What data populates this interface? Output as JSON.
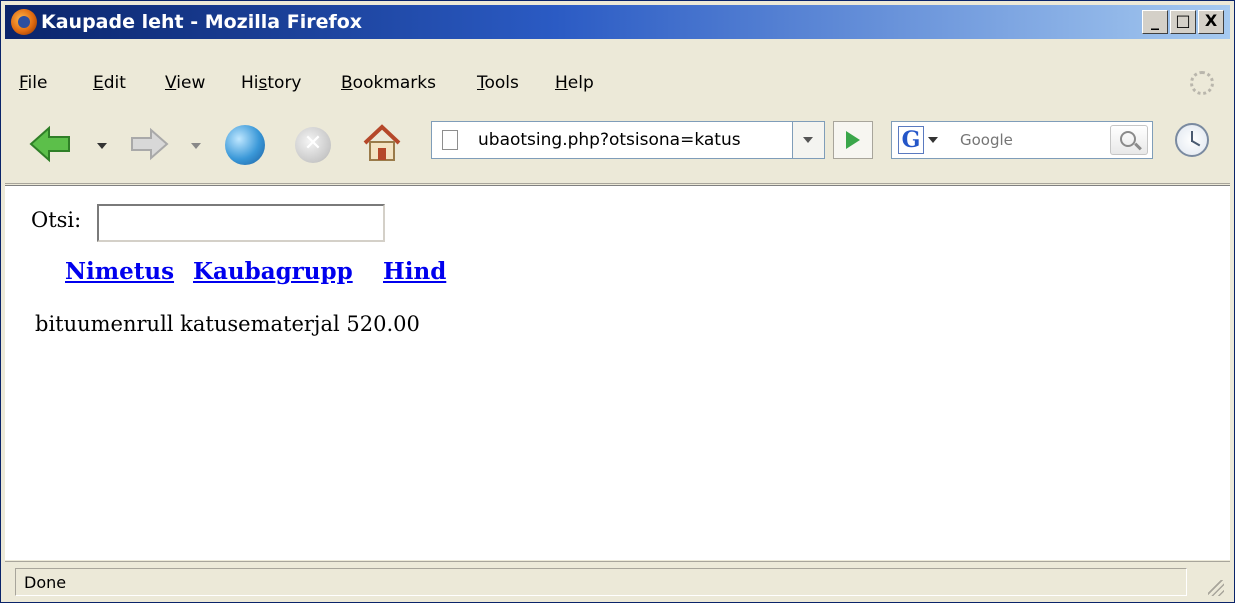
{
  "window": {
    "title": "Kaupade leht - Mozilla Firefox",
    "minimize_label": "_",
    "maximize_label": "□",
    "close_label": "X"
  },
  "menu": {
    "items": [
      {
        "accel": "F",
        "rest": "ile"
      },
      {
        "accel": "E",
        "rest": "dit"
      },
      {
        "accel": "V",
        "rest": "iew"
      },
      {
        "pre": "Hi",
        "accel": "s",
        "rest": "tory"
      },
      {
        "accel": "B",
        "rest": "ookmarks"
      },
      {
        "accel": "T",
        "rest": "ools"
      },
      {
        "accel": "H",
        "rest": "elp"
      }
    ]
  },
  "toolbar": {
    "url": "ubaotsing.php?otsisona=katus",
    "search_placeholder": "Google",
    "stop_glyph": "✕"
  },
  "page": {
    "search_label": "Otsi:",
    "search_value": "",
    "columns": [
      "Nimetus",
      "Kaubagrupp",
      "Hind"
    ],
    "result_text": "bituumenrull katusematerjal 520.00"
  },
  "status": {
    "text": "Done"
  },
  "colors": {
    "title_bar_start": "#0a246a",
    "title_bar_end": "#a6caf0",
    "chrome": "#ece9d8",
    "link": "#0000ee"
  }
}
